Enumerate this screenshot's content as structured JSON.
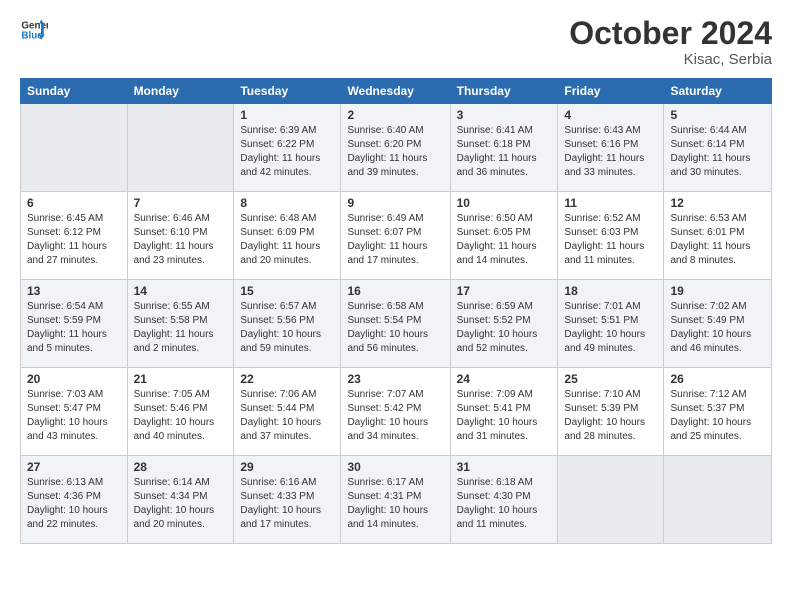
{
  "logo": {
    "line1": "General",
    "line2": "Blue"
  },
  "title": "October 2024",
  "location": "Kisac, Serbia",
  "header_days": [
    "Sunday",
    "Monday",
    "Tuesday",
    "Wednesday",
    "Thursday",
    "Friday",
    "Saturday"
  ],
  "weeks": [
    [
      {
        "day": "",
        "info": ""
      },
      {
        "day": "",
        "info": ""
      },
      {
        "day": "1",
        "info": "Sunrise: 6:39 AM\nSunset: 6:22 PM\nDaylight: 11 hours and 42 minutes."
      },
      {
        "day": "2",
        "info": "Sunrise: 6:40 AM\nSunset: 6:20 PM\nDaylight: 11 hours and 39 minutes."
      },
      {
        "day": "3",
        "info": "Sunrise: 6:41 AM\nSunset: 6:18 PM\nDaylight: 11 hours and 36 minutes."
      },
      {
        "day": "4",
        "info": "Sunrise: 6:43 AM\nSunset: 6:16 PM\nDaylight: 11 hours and 33 minutes."
      },
      {
        "day": "5",
        "info": "Sunrise: 6:44 AM\nSunset: 6:14 PM\nDaylight: 11 hours and 30 minutes."
      }
    ],
    [
      {
        "day": "6",
        "info": "Sunrise: 6:45 AM\nSunset: 6:12 PM\nDaylight: 11 hours and 27 minutes."
      },
      {
        "day": "7",
        "info": "Sunrise: 6:46 AM\nSunset: 6:10 PM\nDaylight: 11 hours and 23 minutes."
      },
      {
        "day": "8",
        "info": "Sunrise: 6:48 AM\nSunset: 6:09 PM\nDaylight: 11 hours and 20 minutes."
      },
      {
        "day": "9",
        "info": "Sunrise: 6:49 AM\nSunset: 6:07 PM\nDaylight: 11 hours and 17 minutes."
      },
      {
        "day": "10",
        "info": "Sunrise: 6:50 AM\nSunset: 6:05 PM\nDaylight: 11 hours and 14 minutes."
      },
      {
        "day": "11",
        "info": "Sunrise: 6:52 AM\nSunset: 6:03 PM\nDaylight: 11 hours and 11 minutes."
      },
      {
        "day": "12",
        "info": "Sunrise: 6:53 AM\nSunset: 6:01 PM\nDaylight: 11 hours and 8 minutes."
      }
    ],
    [
      {
        "day": "13",
        "info": "Sunrise: 6:54 AM\nSunset: 5:59 PM\nDaylight: 11 hours and 5 minutes."
      },
      {
        "day": "14",
        "info": "Sunrise: 6:55 AM\nSunset: 5:58 PM\nDaylight: 11 hours and 2 minutes."
      },
      {
        "day": "15",
        "info": "Sunrise: 6:57 AM\nSunset: 5:56 PM\nDaylight: 10 hours and 59 minutes."
      },
      {
        "day": "16",
        "info": "Sunrise: 6:58 AM\nSunset: 5:54 PM\nDaylight: 10 hours and 56 minutes."
      },
      {
        "day": "17",
        "info": "Sunrise: 6:59 AM\nSunset: 5:52 PM\nDaylight: 10 hours and 52 minutes."
      },
      {
        "day": "18",
        "info": "Sunrise: 7:01 AM\nSunset: 5:51 PM\nDaylight: 10 hours and 49 minutes."
      },
      {
        "day": "19",
        "info": "Sunrise: 7:02 AM\nSunset: 5:49 PM\nDaylight: 10 hours and 46 minutes."
      }
    ],
    [
      {
        "day": "20",
        "info": "Sunrise: 7:03 AM\nSunset: 5:47 PM\nDaylight: 10 hours and 43 minutes."
      },
      {
        "day": "21",
        "info": "Sunrise: 7:05 AM\nSunset: 5:46 PM\nDaylight: 10 hours and 40 minutes."
      },
      {
        "day": "22",
        "info": "Sunrise: 7:06 AM\nSunset: 5:44 PM\nDaylight: 10 hours and 37 minutes."
      },
      {
        "day": "23",
        "info": "Sunrise: 7:07 AM\nSunset: 5:42 PM\nDaylight: 10 hours and 34 minutes."
      },
      {
        "day": "24",
        "info": "Sunrise: 7:09 AM\nSunset: 5:41 PM\nDaylight: 10 hours and 31 minutes."
      },
      {
        "day": "25",
        "info": "Sunrise: 7:10 AM\nSunset: 5:39 PM\nDaylight: 10 hours and 28 minutes."
      },
      {
        "day": "26",
        "info": "Sunrise: 7:12 AM\nSunset: 5:37 PM\nDaylight: 10 hours and 25 minutes."
      }
    ],
    [
      {
        "day": "27",
        "info": "Sunrise: 6:13 AM\nSunset: 4:36 PM\nDaylight: 10 hours and 22 minutes."
      },
      {
        "day": "28",
        "info": "Sunrise: 6:14 AM\nSunset: 4:34 PM\nDaylight: 10 hours and 20 minutes."
      },
      {
        "day": "29",
        "info": "Sunrise: 6:16 AM\nSunset: 4:33 PM\nDaylight: 10 hours and 17 minutes."
      },
      {
        "day": "30",
        "info": "Sunrise: 6:17 AM\nSunset: 4:31 PM\nDaylight: 10 hours and 14 minutes."
      },
      {
        "day": "31",
        "info": "Sunrise: 6:18 AM\nSunset: 4:30 PM\nDaylight: 10 hours and 11 minutes."
      },
      {
        "day": "",
        "info": ""
      },
      {
        "day": "",
        "info": ""
      }
    ]
  ]
}
